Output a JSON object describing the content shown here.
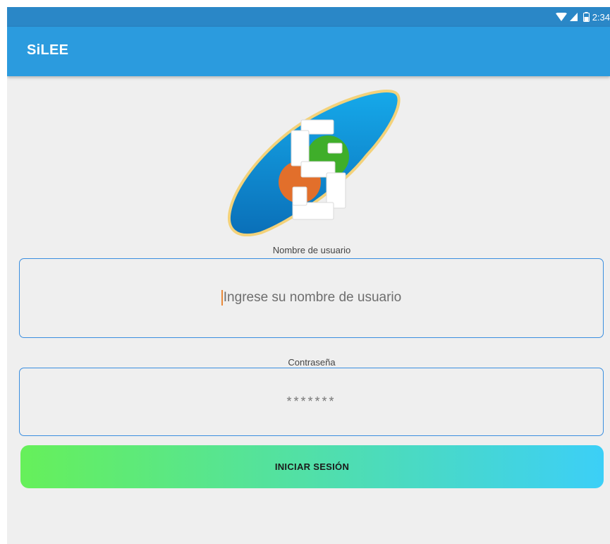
{
  "status_bar": {
    "time": "2:34",
    "icons": [
      "wifi-icon",
      "signal-icon",
      "battery-icon"
    ]
  },
  "app_bar": {
    "title": "SiLEE"
  },
  "logo": {
    "letter": "S",
    "colors": {
      "planet": "#0e8fd6",
      "ring": "#f3d27a",
      "green": "#3fae2a",
      "orange": "#e26f2b"
    }
  },
  "username": {
    "label": "Nombre de usuario",
    "placeholder": "Ingrese su nombre de usuario",
    "value": ""
  },
  "password": {
    "label": "Contraseña",
    "placeholder": "*******",
    "value": ""
  },
  "login_button": {
    "label": "INICIAR SESIÓN",
    "gradient": [
      "#66f05a",
      "#3ccff7"
    ]
  },
  "colors": {
    "status_bar": "#2a87c7",
    "app_bar": "#2b9bde",
    "background": "#efefef",
    "field_border": "#3a8ee0"
  }
}
